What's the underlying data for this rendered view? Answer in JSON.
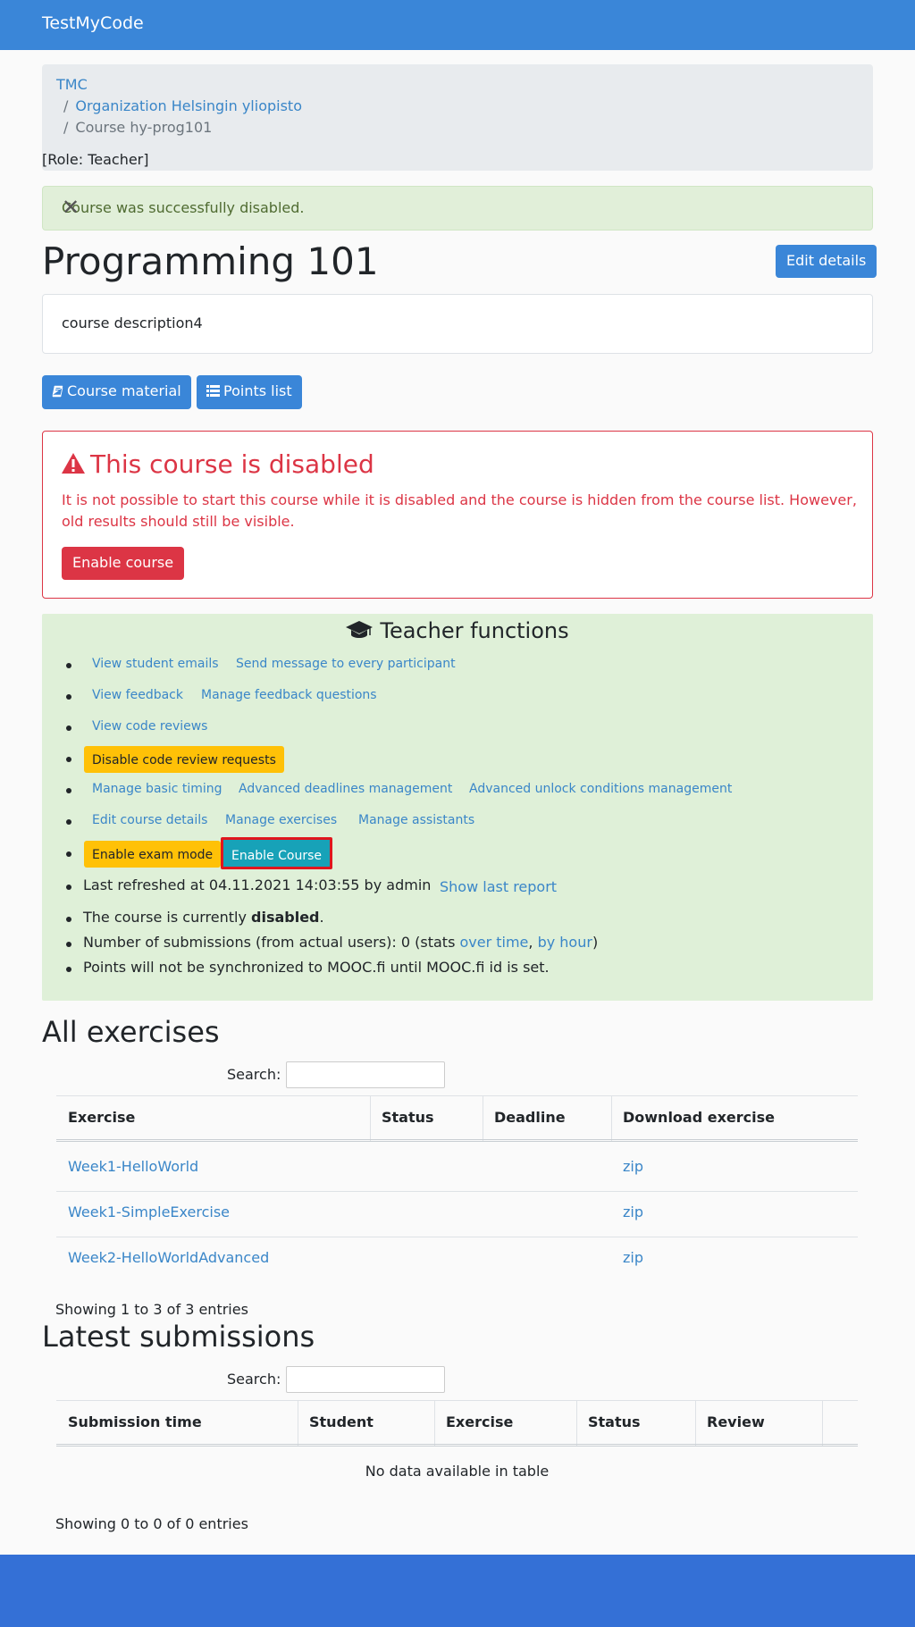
{
  "nav": {
    "brand": "TestMyCode"
  },
  "breadcrumb": {
    "items": [
      "TMC",
      "Organization Helsingin yliopisto",
      "Course hy-prog101"
    ],
    "separator": "/",
    "role": "[Role: Teacher]"
  },
  "flash": {
    "message": "Course was successfully disabled.",
    "close": "✕"
  },
  "course": {
    "title": "Programming 101",
    "edit_label": "Edit details",
    "description": "course description4",
    "material_label": "Course material",
    "points_label": "Points list"
  },
  "disabled_box": {
    "title": "This course is disabled",
    "text": "It is not possible to start this course while it is disabled and the course is hidden from the course list. However, old results should still be visible.",
    "enable_label": "Enable course"
  },
  "teacher": {
    "title": "Teacher functions",
    "links": {
      "student_emails": "View student emails",
      "send_message": "Send message to every participant",
      "view_feedback": "View feedback",
      "manage_feedback": "Manage feedback questions",
      "code_reviews": "View code reviews",
      "disable_review": "Disable code review requests",
      "basic_timing": "Manage basic timing",
      "advanced_deadlines": "Advanced deadlines management",
      "advanced_unlock": "Advanced unlock conditions management",
      "edit_details": "Edit course details",
      "manage_exercises": "Manage exercises",
      "manage_assistants": "Manage assistants",
      "exam_mode": "Enable exam mode",
      "enable_course": "Enable Course",
      "show_report": "Show last report"
    },
    "refreshed": "Last refreshed at 04.11.2021 14:03:55 by admin",
    "status_prefix": "The course is currently ",
    "status_value": "disabled",
    "status_suffix": ".",
    "submissions_prefix": "Number of submissions (from actual users): 0 (stats ",
    "over_time": "over time",
    "comma": ", ",
    "by_hour": "by hour",
    "submissions_suffix": ")",
    "mooc_note": "Points will not be synchronized to MOOC.fi until MOOC.fi id is set."
  },
  "exercises": {
    "title": "All exercises",
    "search_label": "Search:",
    "columns": [
      "Exercise",
      "Status",
      "Deadline",
      "Download exercise"
    ],
    "rows": [
      {
        "name": "Week1-HelloWorld",
        "status": "",
        "deadline": "",
        "download": "zip"
      },
      {
        "name": "Week1-SimpleExercise",
        "status": "",
        "deadline": "",
        "download": "zip"
      },
      {
        "name": "Week2-HelloWorldAdvanced",
        "status": "",
        "deadline": "",
        "download": "zip"
      }
    ],
    "info": "Showing 1 to 3 of 3 entries"
  },
  "submissions": {
    "title": "Latest submissions",
    "search_label": "Search:",
    "columns": [
      "Submission time",
      "Student",
      "Exercise",
      "Status",
      "Review"
    ],
    "empty": "No data available in table",
    "info": "Showing 0 to 0 of 0 entries"
  },
  "colors": {
    "navbar": "#3a86d8",
    "danger": "#dc3545",
    "warning": "#ffc107",
    "info": "#17a2b8",
    "success_bg": "#dff0d8",
    "footer": "#3470d6"
  },
  "icons": {
    "book": "book-icon",
    "list": "list-icon",
    "warning": "warning-triangle-icon",
    "graduation": "graduation-cap-icon",
    "close": "close-icon"
  }
}
